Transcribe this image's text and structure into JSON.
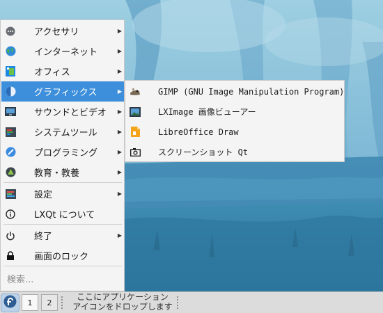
{
  "menu": {
    "items": [
      {
        "label": "アクセサリ",
        "icon": "accessories-icon",
        "submenu": true
      },
      {
        "label": "インターネット",
        "icon": "globe-icon",
        "submenu": true
      },
      {
        "label": "オフィス",
        "icon": "office-icon",
        "submenu": true
      },
      {
        "label": "グラフィックス",
        "icon": "graphics-icon",
        "submenu": true,
        "selected": true
      },
      {
        "label": "サウンドとビデオ",
        "icon": "multimedia-icon",
        "submenu": true
      },
      {
        "label": "システムツール",
        "icon": "system-tools-icon",
        "submenu": true
      },
      {
        "label": "プログラミング",
        "icon": "programming-icon",
        "submenu": true
      },
      {
        "label": "教育・教養",
        "icon": "education-icon",
        "submenu": true
      }
    ],
    "settings": {
      "label": "設定"
    },
    "about": {
      "label": "LXQt について"
    },
    "leave": {
      "label": "終了"
    },
    "lock": {
      "label": "画面のロック"
    },
    "search_placeholder": "検索..."
  },
  "submenu": {
    "items": [
      {
        "label": "GIMP (GNU Image Manipulation Program)",
        "icon": "gimp-icon"
      },
      {
        "label": "LXImage 画像ビューアー",
        "icon": "image-viewer-icon"
      },
      {
        "label": "LibreOffice Draw",
        "icon": "libreoffice-draw-icon"
      },
      {
        "label": "スクリーンショット Qt",
        "icon": "screenshot-icon"
      }
    ]
  },
  "panel": {
    "desktops": [
      "1",
      "2"
    ],
    "quicklaunch_line1": "ここにアプリケーション",
    "quicklaunch_line2": "アイコンをドロップします"
  },
  "colors": {
    "accent": "#3d8fdc",
    "menu_bg": "#f4f4f4",
    "panel_bg": "#dcdcdc"
  }
}
